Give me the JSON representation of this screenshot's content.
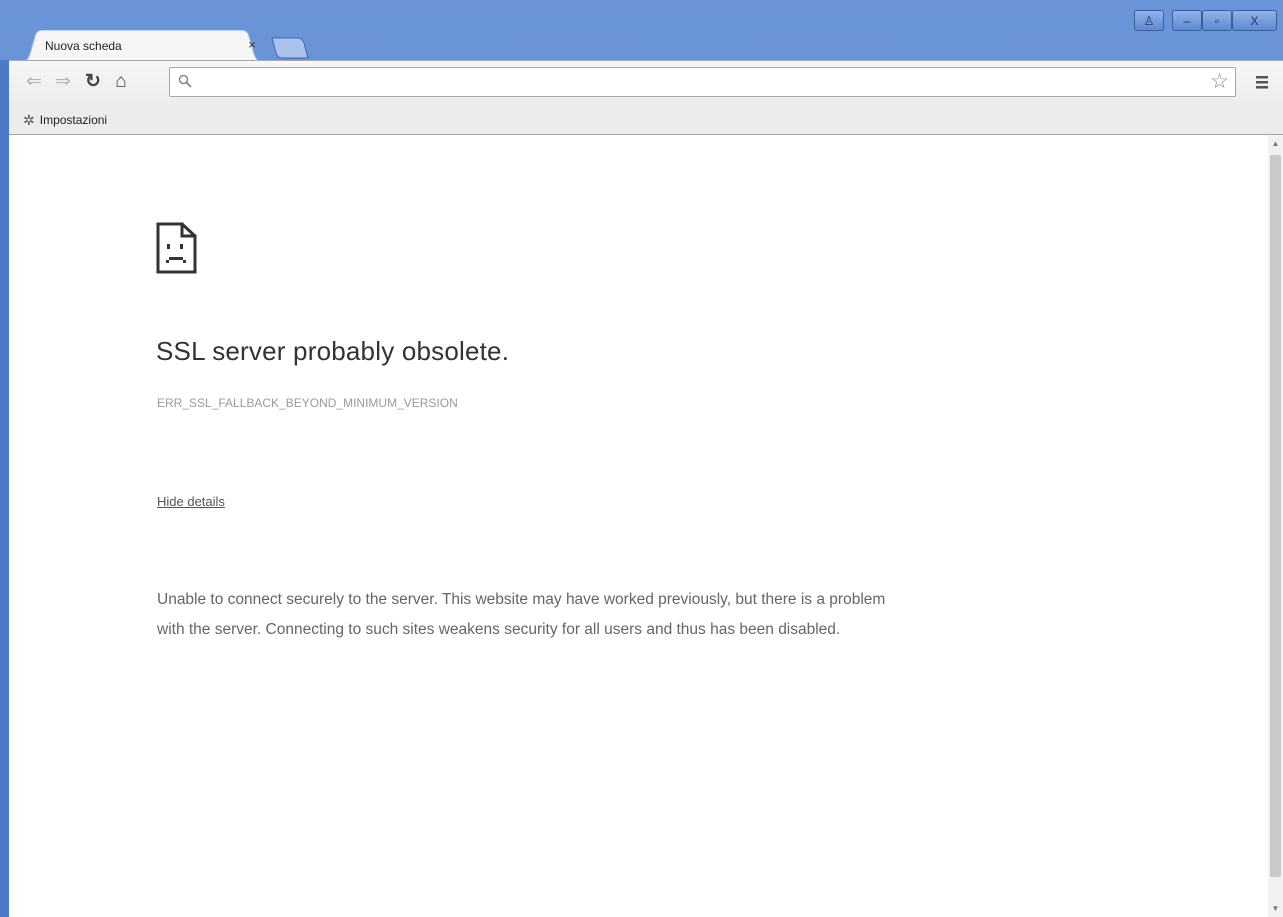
{
  "tab": {
    "title": "Nuova scheda",
    "close_glyph": "×"
  },
  "window_controls": {
    "user_glyph": "♙",
    "minimize_glyph": "–",
    "maximize_glyph": "▫",
    "close_glyph": "X"
  },
  "toolbar": {
    "back_glyph": "⇐",
    "forward_glyph": "⇒",
    "reload_glyph": "↻",
    "home_glyph": "⌂",
    "omnibox_value": "",
    "star_glyph": "☆"
  },
  "bookmarks": {
    "items": [
      {
        "label": "Impostazioni",
        "icon": "gear-icon",
        "glyph": "✲"
      }
    ]
  },
  "error_page": {
    "title": "SSL server probably obsolete.",
    "code": "ERR_SSL_FALLBACK_BEYOND_MINIMUM_VERSION",
    "details_link": "Hide details",
    "description": "Unable to connect securely to the server. This website may have worked previously, but there is a problem with the server. Connecting to such sites weakens security for all users and thus has been disabled."
  },
  "scrollbar": {
    "up_glyph": "▲",
    "down_glyph": "▼"
  },
  "colors": {
    "frame": "#5a86d0",
    "error_text": "#333333",
    "code_text": "#9a9a9a"
  }
}
